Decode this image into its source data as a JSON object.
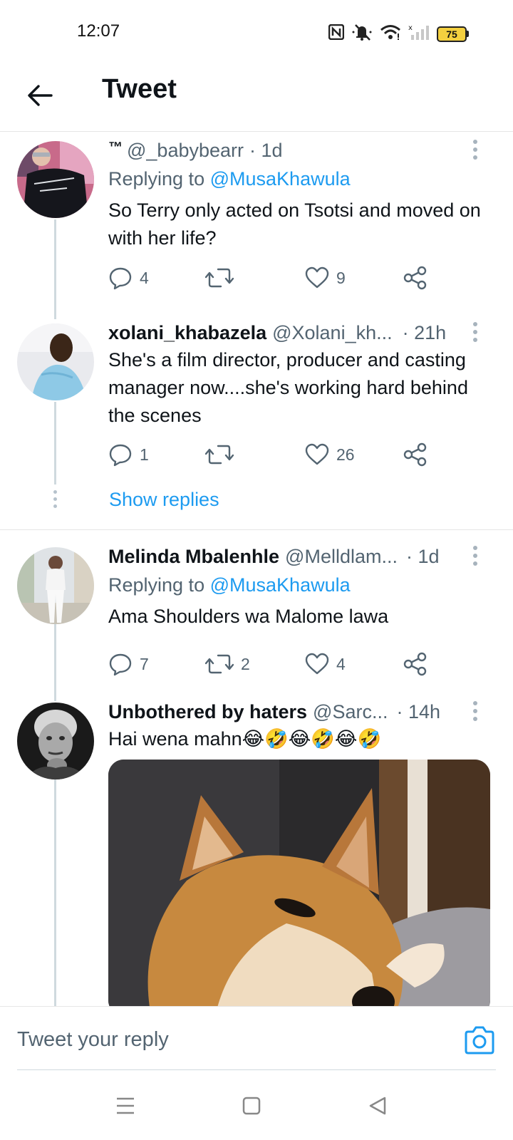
{
  "status_bar": {
    "time": "12:07",
    "battery": "75",
    "icons": [
      "nfc-icon",
      "mute-icon",
      "wifi-icon",
      "signal-icon",
      "battery-icon"
    ]
  },
  "header": {
    "back_icon": "arrow-left-icon",
    "title": "Tweet"
  },
  "colors": {
    "accent": "#1d9bf0",
    "text": "#0f1419",
    "muted": "#536471",
    "thread_line": "#cfd9de"
  },
  "tweets": [
    {
      "tm": "™",
      "author": "",
      "handle": "@_babybearr",
      "time": "· 1d",
      "replying_prefix": "Replying to",
      "replying_to": "@MusaKhawula",
      "text": "So Terry only acted on Tsotsi and moved on with her life?",
      "replies": "4",
      "retweets": "",
      "likes": "9"
    },
    {
      "author": "xolani_khabazela",
      "handle": "@Xolani_kh...",
      "time": "· 21h",
      "text": "She's a film director, producer and casting manager now....she's working hard behind the scenes",
      "replies": "1",
      "retweets": "",
      "likes": "26"
    },
    {
      "author": "Melinda Mbalenhle",
      "handle": "@Melldlam...",
      "time": "· 1d",
      "replying_prefix": "Replying to",
      "replying_to": "@MusaKhawula",
      "text": "Ama Shoulders wa Malome lawa",
      "replies": "7",
      "retweets": "2",
      "likes": "4"
    },
    {
      "author": "Unbothered by haters",
      "handle": "@Sarc...",
      "time": "· 14h",
      "text": "Hai wena mahn😂🤣😂🤣😂🤣"
    }
  ],
  "show_replies": "Show replies",
  "reply_bar": {
    "placeholder": "Tweet your reply",
    "camera_icon": "camera-icon"
  },
  "nav_bar": {
    "icons": [
      "menu-icon",
      "home-square-icon",
      "back-triangle-icon"
    ]
  }
}
